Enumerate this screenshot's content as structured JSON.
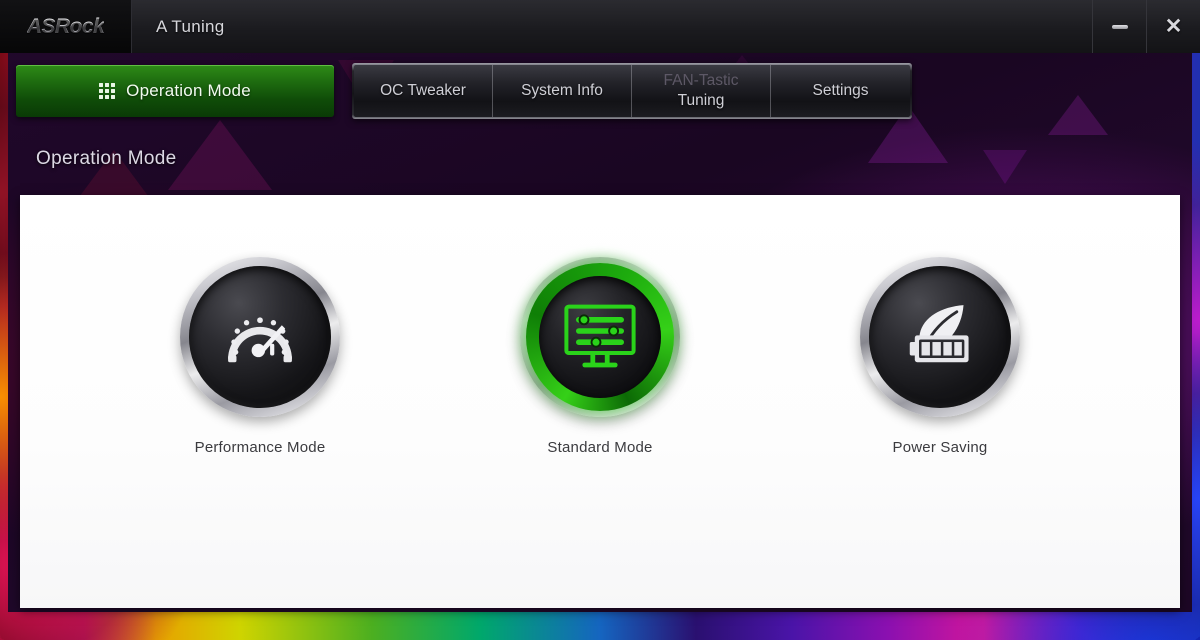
{
  "window": {
    "brand": "ASRock",
    "title": "A Tuning",
    "minimize_label": "–",
    "close_label": "✕"
  },
  "nav": {
    "primary_tab": {
      "label": "Operation Mode",
      "icon": "grid-icon",
      "active": true
    },
    "tabs": [
      {
        "label": "OC Tweaker",
        "line1": "OC Tweaker",
        "line2": ""
      },
      {
        "label": "System Info",
        "line1": "System Info",
        "line2": ""
      },
      {
        "label": "FAN-Tastic Tuning",
        "line1": "FAN-Tastic",
        "line2": "Tuning"
      },
      {
        "label": "Settings",
        "line1": "Settings",
        "line2": ""
      }
    ]
  },
  "page": {
    "heading": "Operation Mode"
  },
  "modes": [
    {
      "label": "Performance Mode",
      "icon": "speedometer-icon",
      "selected": false
    },
    {
      "label": "Standard Mode",
      "icon": "monitor-sliders-icon",
      "selected": true
    },
    {
      "label": "Power Saving",
      "icon": "leaf-battery-icon",
      "selected": false
    }
  ],
  "colors": {
    "accent_green": "#2e8b17",
    "active_ring_green": "#35d018",
    "panel_bg": "#ffffff",
    "titlebar_bg": "#1b1b1f",
    "body_bg": "#1d0725",
    "label_text": "#3b3b3f"
  }
}
